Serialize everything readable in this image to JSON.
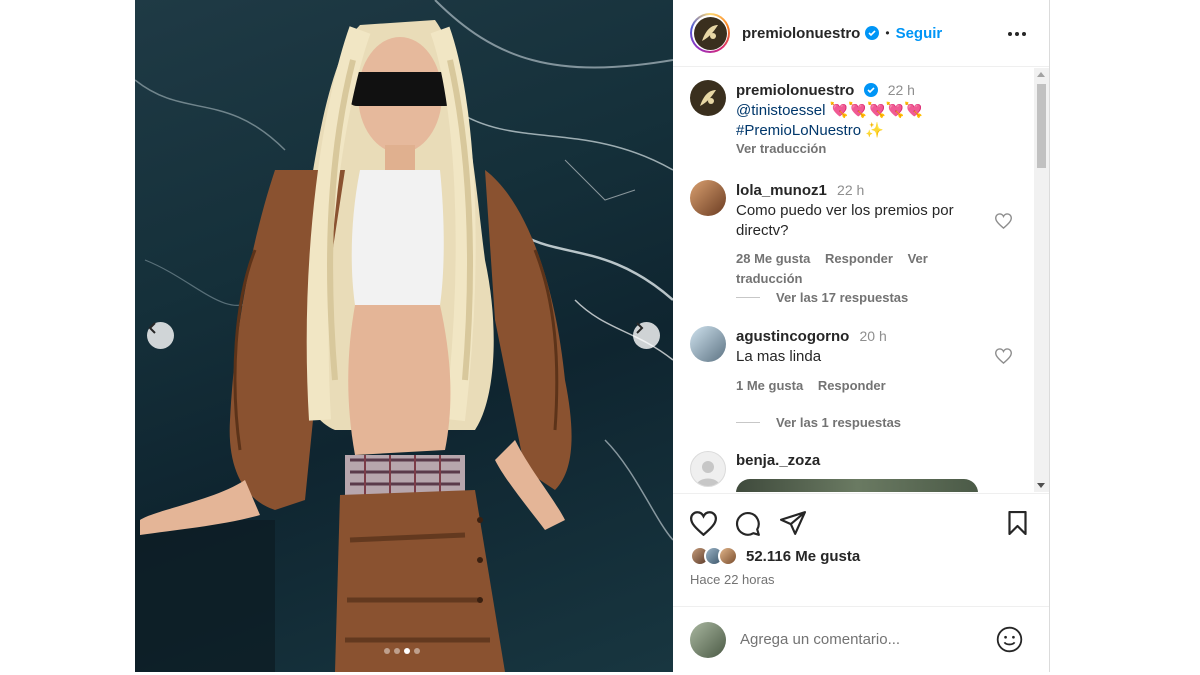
{
  "post": {
    "username": "premiolonuestro",
    "follow_label": "Seguir",
    "separator": "•"
  },
  "caption": {
    "username": "premiolonuestro",
    "time": "22 h",
    "mention": "@tinistoessel",
    "mention_emoji": "💘💘💘💘💘",
    "hashtag": "#PremioLoNuestro",
    "hashtag_emoji": "✨",
    "translate": "Ver traducción"
  },
  "comments": [
    {
      "username": "lola_munoz1",
      "time": "22 h",
      "text": "Como puedo ver los premios por directv?",
      "likes": "28 Me gusta",
      "reply": "Responder",
      "translate": "Ver traducción",
      "replies": "Ver las 17 respuestas"
    },
    {
      "username": "agustincogorno",
      "time": "20 h",
      "text": "La mas linda",
      "likes": "1 Me gusta",
      "reply": "Responder",
      "replies": "Ver las 1 respuestas"
    },
    {
      "username": "benja._zoza"
    }
  ],
  "likes_count": "52.116 Me gusta",
  "posted_ago": "Hace 22 horas",
  "comment_placeholder": "Agrega un comentario...",
  "carousel": {
    "total": 4,
    "active_index": 2
  },
  "colors": {
    "accent": "#0095f6",
    "heart": "#ed4956",
    "link": "#00376b"
  }
}
